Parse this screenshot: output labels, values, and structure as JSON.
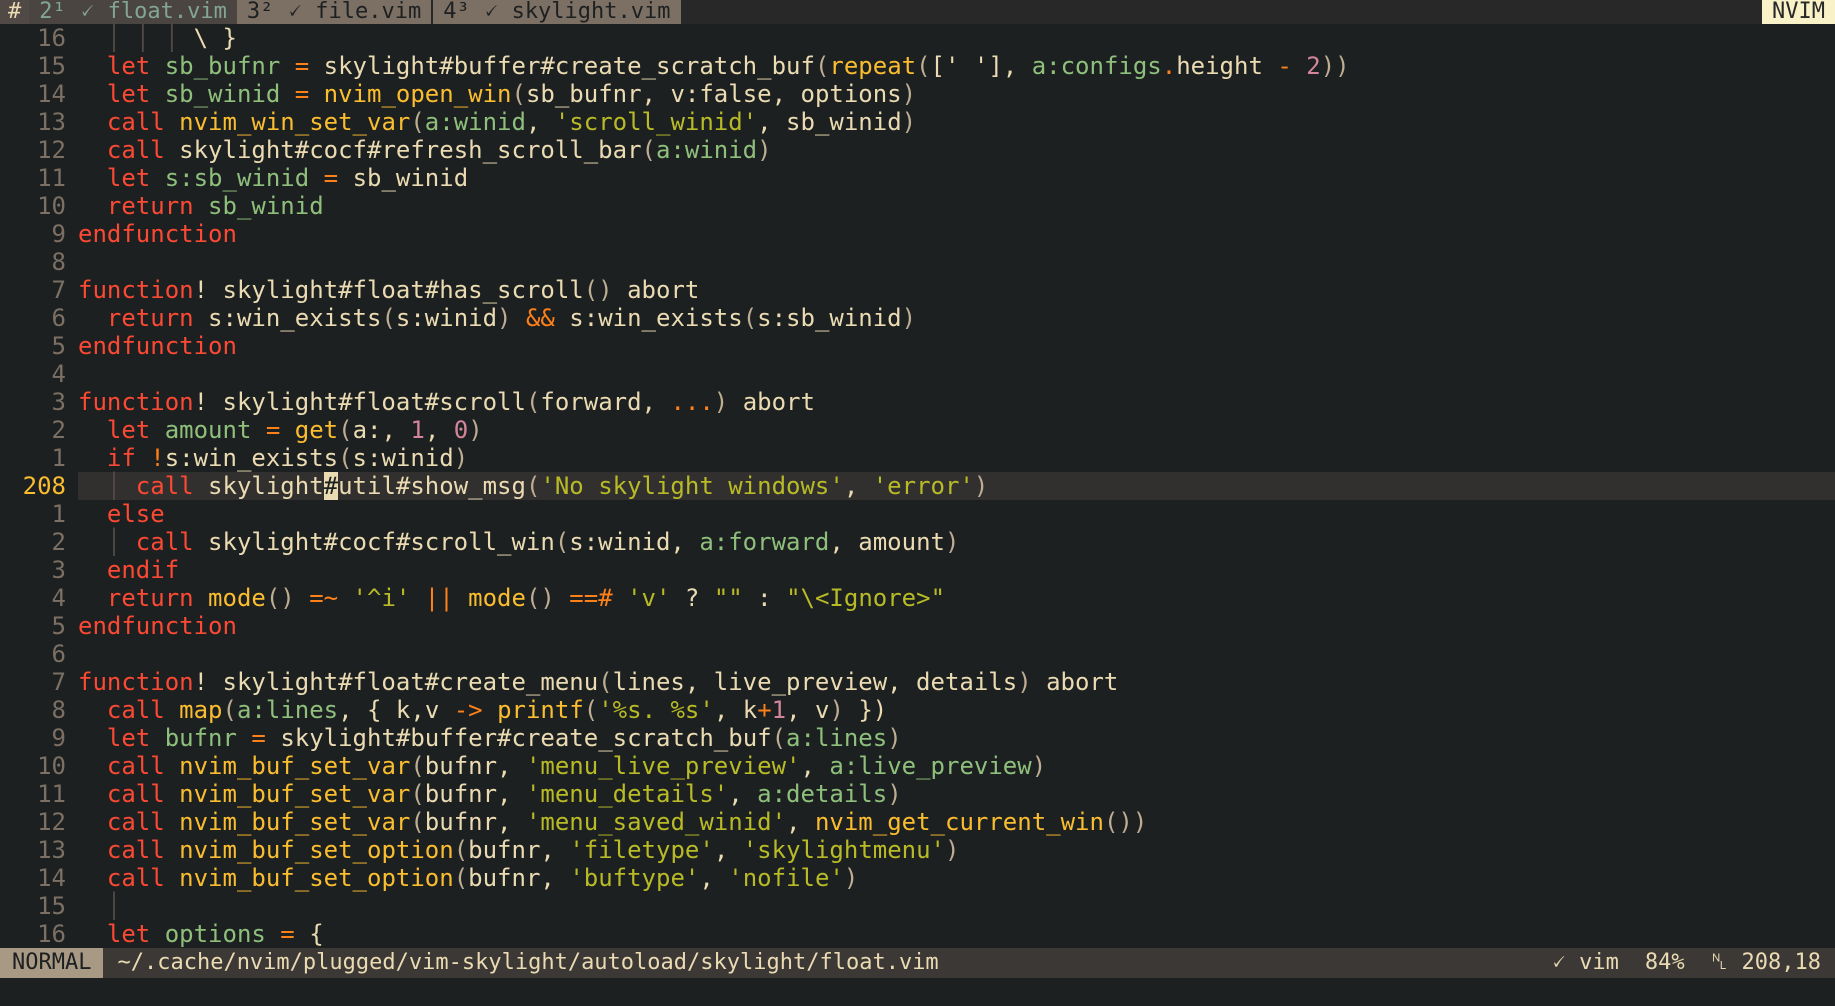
{
  "tabline": {
    "hash": "#",
    "tabs": [
      {
        "label": "2¹ 🗸 float.vim",
        "active": true
      },
      {
        "label": "3² 🗸 file.vim",
        "active": false
      },
      {
        "label": "4³ 🗸 skylight.vim",
        "active": false
      }
    ],
    "app": "NVIM"
  },
  "editor": {
    "cursor_line": 208,
    "lines": [
      {
        "n": "16",
        "code": [
          [
            "guide",
            "  │ │ │ "
          ],
          [
            "pl",
            "\\ }"
          ]
        ]
      },
      {
        "n": "15",
        "code": [
          [
            "kw",
            "  let "
          ],
          [
            "var",
            "sb_bufnr"
          ],
          [
            "op",
            " = "
          ],
          [
            "pl",
            "skylight#buffer#create_scratch_buf"
          ],
          [
            "par",
            "("
          ],
          [
            "fn",
            "repeat"
          ],
          [
            "par",
            "("
          ],
          [
            "pl",
            "[' '], "
          ],
          [
            "var",
            "a:configs"
          ],
          [
            "op",
            "."
          ],
          [
            "pl",
            "height "
          ],
          [
            "op",
            "- "
          ],
          [
            "num",
            "2"
          ],
          [
            "par",
            "))"
          ]
        ]
      },
      {
        "n": "14",
        "code": [
          [
            "kw",
            "  let "
          ],
          [
            "var",
            "sb_winid"
          ],
          [
            "op",
            " = "
          ],
          [
            "fn",
            "nvim_open_win"
          ],
          [
            "par",
            "("
          ],
          [
            "pl",
            "sb_bufnr, v:false, options"
          ],
          [
            "par",
            ")"
          ]
        ]
      },
      {
        "n": "13",
        "code": [
          [
            "kw",
            "  call "
          ],
          [
            "fn",
            "nvim_win_set_var"
          ],
          [
            "par",
            "("
          ],
          [
            "var",
            "a:winid"
          ],
          [
            "pl",
            ", "
          ],
          [
            "str",
            "'scroll_winid'"
          ],
          [
            "pl",
            ", sb_winid"
          ],
          [
            "par",
            ")"
          ]
        ]
      },
      {
        "n": "12",
        "code": [
          [
            "kw",
            "  call "
          ],
          [
            "pl",
            "skylight#cocf#refresh_scroll_bar"
          ],
          [
            "par",
            "("
          ],
          [
            "var",
            "a:winid"
          ],
          [
            "par",
            ")"
          ]
        ]
      },
      {
        "n": "11",
        "code": [
          [
            "kw",
            "  let "
          ],
          [
            "var",
            "s:sb_winid"
          ],
          [
            "op",
            " = "
          ],
          [
            "pl",
            "sb_winid"
          ]
        ]
      },
      {
        "n": "10",
        "code": [
          [
            "kw",
            "  return "
          ],
          [
            "var",
            "sb_winid"
          ]
        ]
      },
      {
        "n": "9",
        "code": [
          [
            "kw",
            "endfunction"
          ]
        ]
      },
      {
        "n": "8",
        "code": []
      },
      {
        "n": "7",
        "code": [
          [
            "kw",
            "function"
          ],
          [
            "pl",
            "! skylight#float#has_scroll"
          ],
          [
            "par",
            "()"
          ],
          [
            "pl",
            " abort"
          ]
        ]
      },
      {
        "n": "6",
        "code": [
          [
            "kw",
            "  return "
          ],
          [
            "pl",
            "s:win_exists"
          ],
          [
            "par",
            "("
          ],
          [
            "pl",
            "s:winid"
          ],
          [
            "par",
            ")"
          ],
          [
            "op",
            " && "
          ],
          [
            "pl",
            "s:win_exists"
          ],
          [
            "par",
            "("
          ],
          [
            "pl",
            "s:sb_winid"
          ],
          [
            "par",
            ")"
          ]
        ]
      },
      {
        "n": "5",
        "code": [
          [
            "kw",
            "endfunction"
          ]
        ]
      },
      {
        "n": "4",
        "code": []
      },
      {
        "n": "3",
        "code": [
          [
            "kw",
            "function"
          ],
          [
            "pl",
            "! skylight#float#scroll"
          ],
          [
            "par",
            "("
          ],
          [
            "pl",
            "forward, "
          ],
          [
            "op",
            "..."
          ],
          [
            "par",
            ")"
          ],
          [
            "pl",
            " abort"
          ]
        ]
      },
      {
        "n": "2",
        "code": [
          [
            "kw",
            "  let "
          ],
          [
            "var",
            "amount"
          ],
          [
            "op",
            " = "
          ],
          [
            "fn",
            "get"
          ],
          [
            "par",
            "("
          ],
          [
            "pl",
            "a:, "
          ],
          [
            "num",
            "1"
          ],
          [
            "pl",
            ", "
          ],
          [
            "num",
            "0"
          ],
          [
            "par",
            ")"
          ]
        ]
      },
      {
        "n": "1",
        "code": [
          [
            "kw",
            "  if "
          ],
          [
            "op",
            "!"
          ],
          [
            "pl",
            "s:win_exists"
          ],
          [
            "par",
            "("
          ],
          [
            "pl",
            "s:winid"
          ],
          [
            "par",
            ")"
          ]
        ]
      },
      {
        "n": "208",
        "code": [
          [
            "guide",
            "  │ "
          ],
          [
            "kw",
            "call "
          ],
          [
            "pl",
            "skylight"
          ],
          [
            "cursor",
            "#"
          ],
          [
            "pl",
            "util#show_msg"
          ],
          [
            "par",
            "("
          ],
          [
            "str",
            "'No skylight windows'"
          ],
          [
            "pl",
            ", "
          ],
          [
            "str",
            "'error'"
          ],
          [
            "par",
            ")"
          ]
        ]
      },
      {
        "n": "1",
        "code": [
          [
            "kw",
            "  else"
          ]
        ]
      },
      {
        "n": "2",
        "code": [
          [
            "guide",
            "  │ "
          ],
          [
            "kw",
            "call "
          ],
          [
            "pl",
            "skylight#cocf#scroll_win"
          ],
          [
            "par",
            "("
          ],
          [
            "pl",
            "s:winid, "
          ],
          [
            "var",
            "a:forward"
          ],
          [
            "pl",
            ", amount"
          ],
          [
            "par",
            ")"
          ]
        ]
      },
      {
        "n": "3",
        "code": [
          [
            "kw",
            "  endif"
          ]
        ]
      },
      {
        "n": "4",
        "code": [
          [
            "kw",
            "  return "
          ],
          [
            "fn",
            "mode"
          ],
          [
            "par",
            "()"
          ],
          [
            "op",
            " =~ "
          ],
          [
            "str",
            "'^i'"
          ],
          [
            "op",
            " || "
          ],
          [
            "fn",
            "mode"
          ],
          [
            "par",
            "()"
          ],
          [
            "op",
            " ==# "
          ],
          [
            "str",
            "'v'"
          ],
          [
            "pl",
            " ? "
          ],
          [
            "str",
            "\"\""
          ],
          [
            "pl",
            " : "
          ],
          [
            "str",
            "\"\\<Ignore>\""
          ]
        ]
      },
      {
        "n": "5",
        "code": [
          [
            "kw",
            "endfunction"
          ]
        ]
      },
      {
        "n": "6",
        "code": []
      },
      {
        "n": "7",
        "code": [
          [
            "kw",
            "function"
          ],
          [
            "pl",
            "! skylight#float#create_menu"
          ],
          [
            "par",
            "("
          ],
          [
            "pl",
            "lines, live_preview, details"
          ],
          [
            "par",
            ")"
          ],
          [
            "pl",
            " abort"
          ]
        ]
      },
      {
        "n": "8",
        "code": [
          [
            "kw",
            "  call "
          ],
          [
            "fn",
            "map"
          ],
          [
            "par",
            "("
          ],
          [
            "var",
            "a:lines"
          ],
          [
            "pl",
            ", { k,v "
          ],
          [
            "op",
            "->"
          ],
          [
            "fn",
            " printf"
          ],
          [
            "par",
            "("
          ],
          [
            "str",
            "'%s. %s'"
          ],
          [
            "pl",
            ", k"
          ],
          [
            "op",
            "+"
          ],
          [
            "num",
            "1"
          ],
          [
            "pl",
            ", v"
          ],
          [
            "par",
            ")"
          ],
          [
            "pl",
            " })"
          ]
        ]
      },
      {
        "n": "9",
        "code": [
          [
            "kw",
            "  let "
          ],
          [
            "var",
            "bufnr"
          ],
          [
            "op",
            " = "
          ],
          [
            "pl",
            "skylight#buffer#create_scratch_buf"
          ],
          [
            "par",
            "("
          ],
          [
            "var",
            "a:lines"
          ],
          [
            "par",
            ")"
          ]
        ]
      },
      {
        "n": "10",
        "code": [
          [
            "kw",
            "  call "
          ],
          [
            "fn",
            "nvim_buf_set_var"
          ],
          [
            "par",
            "("
          ],
          [
            "pl",
            "bufnr, "
          ],
          [
            "str",
            "'menu_live_preview'"
          ],
          [
            "pl",
            ", "
          ],
          [
            "var",
            "a:live_preview"
          ],
          [
            "par",
            ")"
          ]
        ]
      },
      {
        "n": "11",
        "code": [
          [
            "kw",
            "  call "
          ],
          [
            "fn",
            "nvim_buf_set_var"
          ],
          [
            "par",
            "("
          ],
          [
            "pl",
            "bufnr, "
          ],
          [
            "str",
            "'menu_details'"
          ],
          [
            "pl",
            ", "
          ],
          [
            "var",
            "a:details"
          ],
          [
            "par",
            ")"
          ]
        ]
      },
      {
        "n": "12",
        "code": [
          [
            "kw",
            "  call "
          ],
          [
            "fn",
            "nvim_buf_set_var"
          ],
          [
            "par",
            "("
          ],
          [
            "pl",
            "bufnr, "
          ],
          [
            "str",
            "'menu_saved_winid'"
          ],
          [
            "pl",
            ", "
          ],
          [
            "fn",
            "nvim_get_current_win"
          ],
          [
            "par",
            "())"
          ]
        ]
      },
      {
        "n": "13",
        "code": [
          [
            "kw",
            "  call "
          ],
          [
            "fn",
            "nvim_buf_set_option"
          ],
          [
            "par",
            "("
          ],
          [
            "pl",
            "bufnr, "
          ],
          [
            "str",
            "'filetype'"
          ],
          [
            "pl",
            ", "
          ],
          [
            "str",
            "'skylightmenu'"
          ],
          [
            "par",
            ")"
          ]
        ]
      },
      {
        "n": "14",
        "code": [
          [
            "kw",
            "  call "
          ],
          [
            "fn",
            "nvim_buf_set_option"
          ],
          [
            "par",
            "("
          ],
          [
            "pl",
            "bufnr, "
          ],
          [
            "str",
            "'buftype'"
          ],
          [
            "pl",
            ", "
          ],
          [
            "str",
            "'nofile'"
          ],
          [
            "par",
            ")"
          ]
        ]
      },
      {
        "n": "15",
        "code": [
          [
            "guide",
            "  │"
          ]
        ]
      },
      {
        "n": "16",
        "code": [
          [
            "kw",
            "  let "
          ],
          [
            "var",
            "options"
          ],
          [
            "op",
            " = "
          ],
          [
            "pl",
            "{"
          ]
        ]
      }
    ]
  },
  "statusline": {
    "mode": "NORMAL",
    "filepath": "~/.cache/nvim/plugged/vim-skylight/autoload/skylight/float.vim",
    "filetype": "🗸 vim",
    "percent": "84%",
    "position": "␤ 208,18"
  }
}
